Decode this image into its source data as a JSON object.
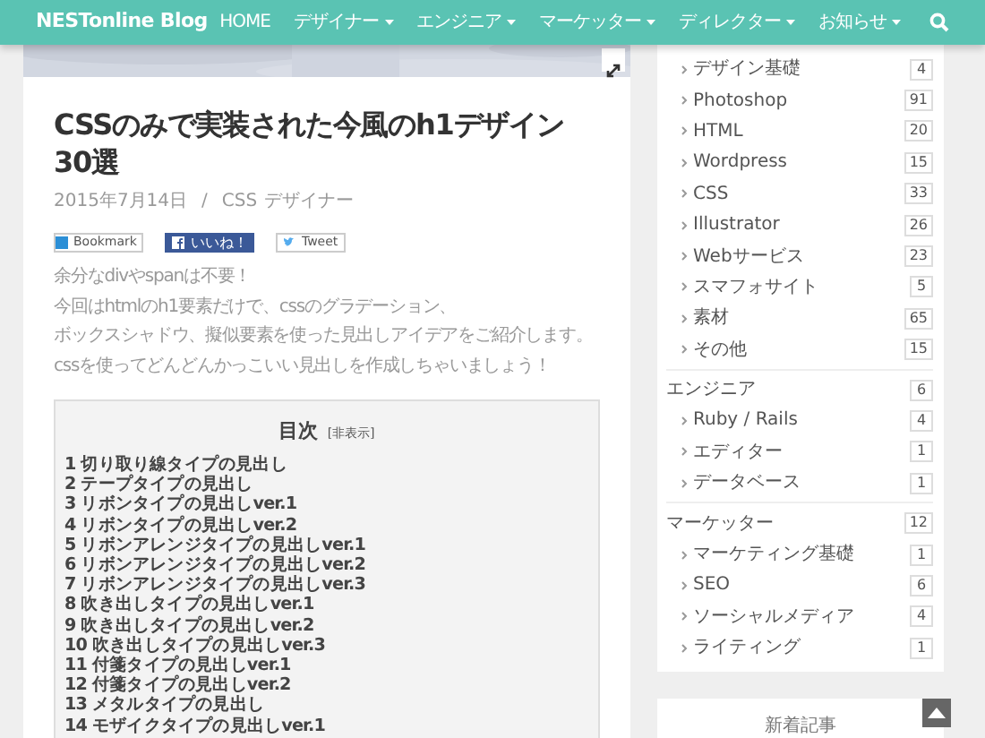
{
  "navbar": {
    "brand": "NESTonline Blog",
    "menu": [
      {
        "label": "HOME",
        "dropdown": false
      },
      {
        "label": "デザイナー",
        "dropdown": true
      },
      {
        "label": "エンジニア",
        "dropdown": true
      },
      {
        "label": "マーケッター",
        "dropdown": true
      },
      {
        "label": "ディレクター",
        "dropdown": true
      },
      {
        "label": "お知らせ",
        "dropdown": true
      }
    ]
  },
  "article": {
    "title": "CSSのみで実装された今風のh1デザイン30選",
    "date": "2015年7月14日",
    "separator": "/",
    "categories": [
      "CSS",
      "デザイナー"
    ],
    "share": [
      {
        "kind": "hatena",
        "label": "Bookmark"
      },
      {
        "kind": "facebook",
        "label": "いいね！"
      },
      {
        "kind": "twitter",
        "label": "Tweet"
      }
    ],
    "paragraphs": [
      "余分なdivやspanは不要！",
      "今回はhtmlのh1要素だけで、cssのグラデーション、",
      "ボックスシャドウ、擬似要素を使った見出しアイデアをご紹介します。",
      "cssを使ってどんどんかっこいい見出しを作成しちゃいましょう！"
    ],
    "toc": {
      "title": "目次",
      "toggle": "[非表示]",
      "items": [
        "1 切り取り線タイプの見出し",
        "2 テープタイプの見出し",
        "3 リボンタイプの見出しver.1",
        "4 リボンタイプの見出しver.2",
        "5 リボンアレンジタイプの見出しver.1",
        "6 リボンアレンジタイプの見出しver.2",
        "7 リボンアレンジタイプの見出しver.3",
        "8 吹き出しタイプの見出しver.1",
        "9 吹き出しタイプの見出しver.2",
        "10 吹き出しタイプの見出しver.3",
        "11 付箋タイプの見出しver.1",
        "12 付箋タイプの見出しver.2",
        "13 メタルタイプの見出し",
        "14 モザイクタイプの見出しver.1"
      ]
    }
  },
  "sidebar": {
    "groups": [
      {
        "children": [
          {
            "label": "デザイン基礎",
            "count": "4"
          },
          {
            "label": "Photoshop",
            "count": "91"
          },
          {
            "label": "HTML",
            "count": "20"
          },
          {
            "label": "Wordpress",
            "count": "15"
          },
          {
            "label": "CSS",
            "count": "33"
          },
          {
            "label": "Illustrator",
            "count": "26"
          },
          {
            "label": "Webサービス",
            "count": "23"
          },
          {
            "label": "スマフォサイト",
            "count": "5"
          },
          {
            "label": "素材",
            "count": "65"
          },
          {
            "label": "その他",
            "count": "15"
          }
        ]
      },
      {
        "label": "エンジニア",
        "count": "6",
        "children": [
          {
            "label": "Ruby / Rails",
            "count": "4"
          },
          {
            "label": "エディター",
            "count": "1"
          },
          {
            "label": "データベース",
            "count": "1"
          }
        ]
      },
      {
        "label": "マーケッター",
        "count": "12",
        "children": [
          {
            "label": "マーケティング基礎",
            "count": "1"
          },
          {
            "label": "SEO",
            "count": "6"
          },
          {
            "label": "ソーシャルメディア",
            "count": "4"
          },
          {
            "label": "ライティング",
            "count": "1"
          }
        ]
      }
    ]
  },
  "new_posts": {
    "title": "新着記事"
  }
}
